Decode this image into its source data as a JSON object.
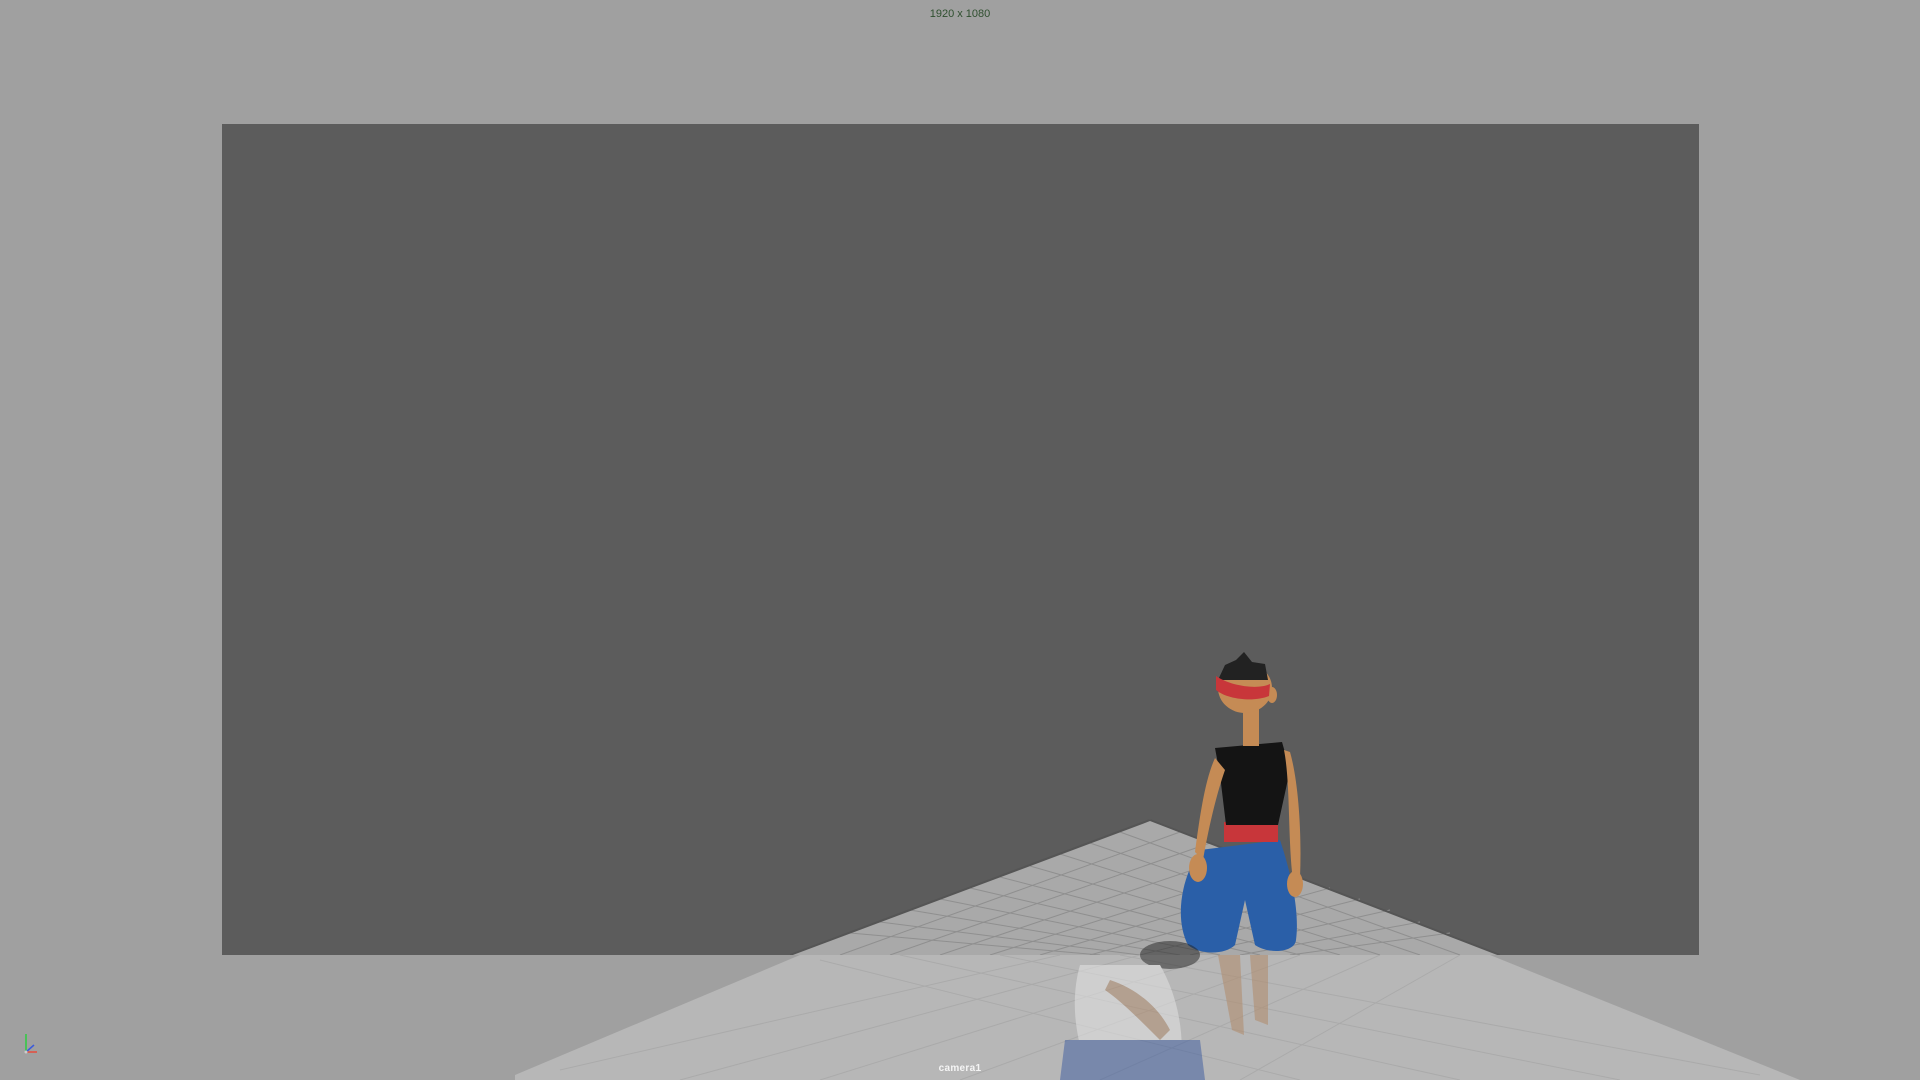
{
  "viewport": {
    "resolution_label": "1920 x 1080",
    "camera_name": "camera1"
  },
  "colors": {
    "background": "#a0a0a0",
    "gate": "#5c5c5c",
    "resolution_label": "#2f4f2f",
    "camera_label": "#f5f5f5"
  },
  "icons": {
    "axis": "xyz-axis-icon"
  }
}
